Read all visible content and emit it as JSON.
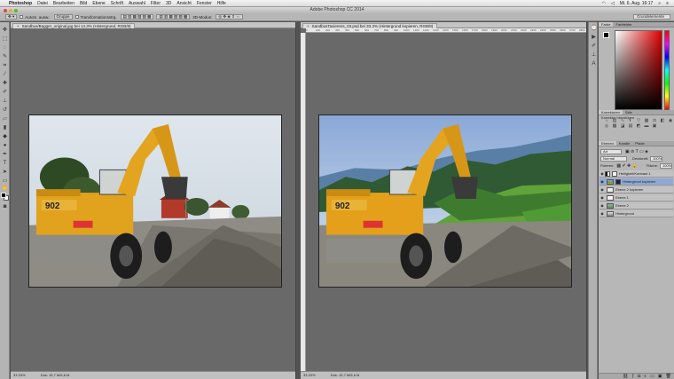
{
  "menubar": {
    "apple_icon": "",
    "app": "Photoshop",
    "items": [
      "Datei",
      "Bearbeiten",
      "Bild",
      "Ebene",
      "Schrift",
      "Auswahl",
      "Filter",
      "3D",
      "Ansicht",
      "Fenster",
      "Hilfe"
    ],
    "clock": "Mi. 6. Aug.  16:17"
  },
  "window": {
    "title": "Adobe Photoshop CC 2014"
  },
  "optbar": {
    "auto_select_label": "Autom. ausw.:",
    "auto_select_value": "Gruppe",
    "transform_label": "Transformationsstrg.",
    "mode_3d": "3D-Modus:",
    "workspace": "Grundelemente"
  },
  "doc_left": {
    "tab": "Sandbus/Bagger_original.jpg bei 14.3% (Hintergrund, RGB/8)",
    "zoom": "33.33%",
    "size": "Dok: 15,7 M/6,6 M"
  },
  "doc_right": {
    "tab": "SandbusTaxierens_03.psd bei 33.3% (Hintergrund kopieren, RGB/8)",
    "zoom": "33.33%",
    "size": "Dok: 15,7 M/6,6 M",
    "ruler": [
      "0",
      "100",
      "200",
      "300",
      "400",
      "500",
      "600",
      "700",
      "800",
      "900",
      "1000",
      "1100",
      "1200",
      "1300",
      "1400",
      "1500",
      "1600",
      "1700",
      "1800",
      "1900",
      "2000",
      "2100",
      "2200",
      "2300",
      "2400",
      "2500",
      "2600",
      "2700",
      "2800"
    ]
  },
  "panels": {
    "color_tabs": [
      "Farbe",
      "Farbfelder"
    ],
    "adjust_tabs": [
      "Korrekturen",
      "Stile"
    ],
    "adjust_title": "Korrektur hinzufügen",
    "layer_tabs": [
      "Ebenen",
      "Kanäle",
      "Pfade"
    ],
    "kind": "Art",
    "blend": "Normal",
    "opacity_label": "Deckkraft:",
    "opacity": "100%",
    "lock_label": "Fixieren:",
    "fill_label": "Fläche:",
    "fill": "100%",
    "layers": [
      {
        "name": "Helligkeit/Kontrast 1",
        "selected": false
      },
      {
        "name": "Hintergrund kopieren",
        "selected": true
      },
      {
        "name": "Ebene 2 kopieren",
        "selected": false
      },
      {
        "name": "Ebene 1",
        "selected": false
      },
      {
        "name": "Ebene 2",
        "selected": false
      },
      {
        "name": "Hintergrund",
        "selected": false
      }
    ]
  },
  "colors": {
    "ui_gray": "#696969",
    "panel": "#b7b7b7",
    "selection": "#8fa8d8"
  }
}
